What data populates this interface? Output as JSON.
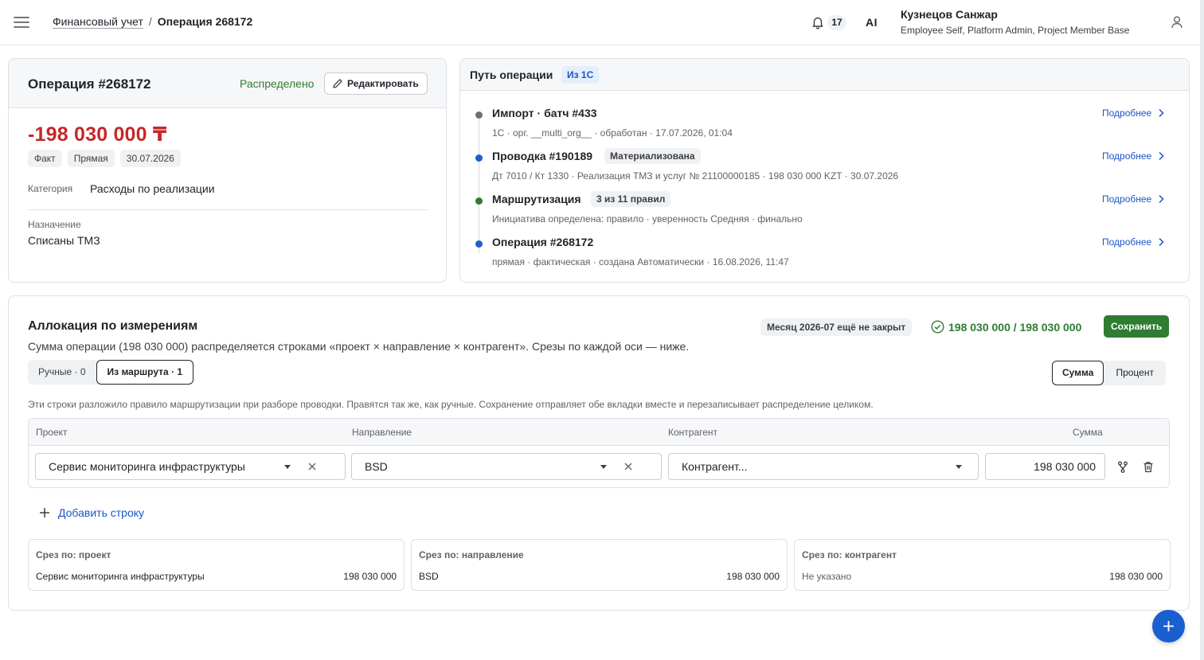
{
  "header": {
    "breadcrumb_parent": "Финансовый учет",
    "breadcrumb_sep": "/",
    "breadcrumb_current": "Операция 268172",
    "notifications_count": "17",
    "ai_label": "AI",
    "user_name": "Кузнецов Санжар",
    "user_roles": "Employee Self, Platform Admin, Project Member Base",
    "icons": [
      "menu-icon",
      "bell-icon",
      "user-icon"
    ]
  },
  "operation": {
    "title": "Операция #268172",
    "status": "Распределено",
    "edit_label": "Редактировать",
    "amount": "-198 030 000 ₸",
    "chips": [
      "Факт",
      "Прямая",
      "30.07.2026"
    ],
    "category_label": "Категория",
    "category_value": "Расходы по реализации",
    "purpose_label": "Назначение",
    "purpose_value": "Списаны ТМЗ"
  },
  "path": {
    "title": "Путь операции",
    "badge": "Из 1С",
    "more_label": "Подробнее",
    "steps": [
      {
        "title": "Импорт · батч #433",
        "badge": "",
        "sub": "1С · орг. __multi_org__ · обработан · 17.07.2026, 01:04",
        "dot_color": "#6b6f75"
      },
      {
        "title": "Проводка #190189",
        "badge": "Материализована",
        "sub": "Дт 7010 / Кт 1330 · Реализация ТМЗ и услуг № 21100000185 · 198 030 000 KZT · 30.07.2026",
        "dot_color": "#1a5fcf"
      },
      {
        "title": "Маршрутизация",
        "badge": "3 из 11 правил",
        "sub": "Инициатива определена: правило · уверенность Средняя · финально",
        "dot_color": "#2e7d32"
      },
      {
        "title": "Операция #268172",
        "badge": "",
        "sub": "прямая · фактическая · создана Автоматически · 16.08.2026, 11:47",
        "dot_color": "#1a5fcf"
      }
    ]
  },
  "allocation": {
    "title": "Аллокация по измерениям",
    "description": "Сумма операции (198 030 000) распределяется строками «проект × направление × контрагент». Срезы по каждой оси — ниже.",
    "month_chip": "Месяц 2026-07 ещё не закрыт",
    "balance": "198 030 000 / 198 030 000",
    "save_label": "Сохранить",
    "tabs": [
      "Ручные · 0",
      "Из маршрута · 1"
    ],
    "active_tab": 1,
    "mode_tabs": [
      "Сумма",
      "Процент"
    ],
    "active_mode": 0,
    "route_note": "Эти строки разложило правило маршрутизации при разборе проводки. Правятся так же, как ручные. Сохранение отправляет обе вкладки вместе и перезаписывает распределение целиком.",
    "columns": [
      "Проект",
      "Направление",
      "Контрагент",
      "Сумма"
    ],
    "row": {
      "project": "Сервис мониторинга инфраструктуры",
      "direction": "BSD",
      "counterparty_placeholder": "Контрагент...",
      "amount": "198 030 000"
    },
    "add_row_label": "Добавить строку",
    "slices": [
      {
        "title": "Срез по: проект",
        "name": "Сервис мониторинга инфраструктуры",
        "value": "198 030 000"
      },
      {
        "title": "Срез по: направление",
        "name": "BSD",
        "value": "198 030 000"
      },
      {
        "title": "Срез по: контрагент",
        "name": "Не указано",
        "value": "198 030 000"
      }
    ]
  },
  "colors": {
    "accent_blue": "#1a56c4",
    "success_green": "#2e7d32",
    "negative_red": "#c62828"
  }
}
